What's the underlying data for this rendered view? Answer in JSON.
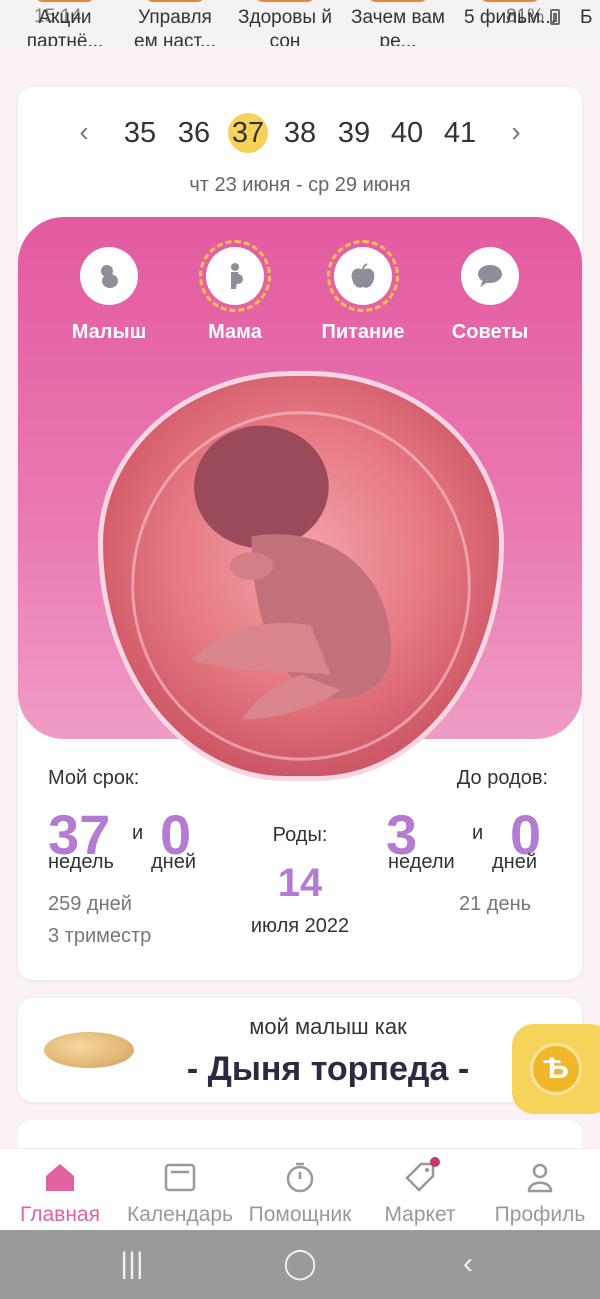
{
  "stories": [
    {
      "label": "Акции партнё..."
    },
    {
      "label": "Управля ем наст..."
    },
    {
      "label": "Здоровы й сон"
    },
    {
      "label": "Зачем вам ре..."
    },
    {
      "label": "5 фильм..."
    },
    {
      "label": "Б"
    }
  ],
  "status": {
    "time": "15:14",
    "battery": "81%"
  },
  "weeks": {
    "items": [
      "35",
      "36",
      "37",
      "38",
      "39",
      "40",
      "41"
    ],
    "active": "37",
    "prev_icon": "chevron-left-icon",
    "next_icon": "chevron-right-icon",
    "date_range": "чт 23 июня - ср 29 июня"
  },
  "categories": [
    {
      "label": "Малыш",
      "icon": "baby-icon"
    },
    {
      "label": "Мама",
      "icon": "mother-icon"
    },
    {
      "label": "Питание",
      "icon": "apple-icon"
    },
    {
      "label": "Советы",
      "icon": "chat-bubble-icon"
    }
  ],
  "term": {
    "title": "Мой срок:",
    "weeks_value": "37",
    "and": "и",
    "days_value": "0",
    "weeks_unit": "недель",
    "days_unit": "дней",
    "days_total": "259 дней",
    "trimester": "3 триместр"
  },
  "birth": {
    "title": "Роды:",
    "day": "14",
    "month_year": "июля 2022"
  },
  "until": {
    "title": "До родов:",
    "weeks_value": "3",
    "and": "и",
    "days_value": "0",
    "weeks_unit": "недели",
    "days_unit": "дней",
    "days_total": "21 день"
  },
  "compare": {
    "subtitle": "мой малыш как",
    "title": "- Дыня торпеда -"
  },
  "bottom_nav": [
    {
      "label": "Главная",
      "icon": "home-icon",
      "active": true
    },
    {
      "label": "Календарь",
      "icon": "calendar-icon",
      "active": false
    },
    {
      "label": "Помощник",
      "icon": "stopwatch-icon",
      "active": false
    },
    {
      "label": "Маркет",
      "icon": "tag-icon",
      "active": false
    },
    {
      "label": "Профиль",
      "icon": "profile-icon",
      "active": false
    }
  ],
  "colors": {
    "accent_pink": "#e35aa0",
    "number_purple": "#b57ad1",
    "active_week": "#f7d25a",
    "nav_active": "#e0629e"
  }
}
